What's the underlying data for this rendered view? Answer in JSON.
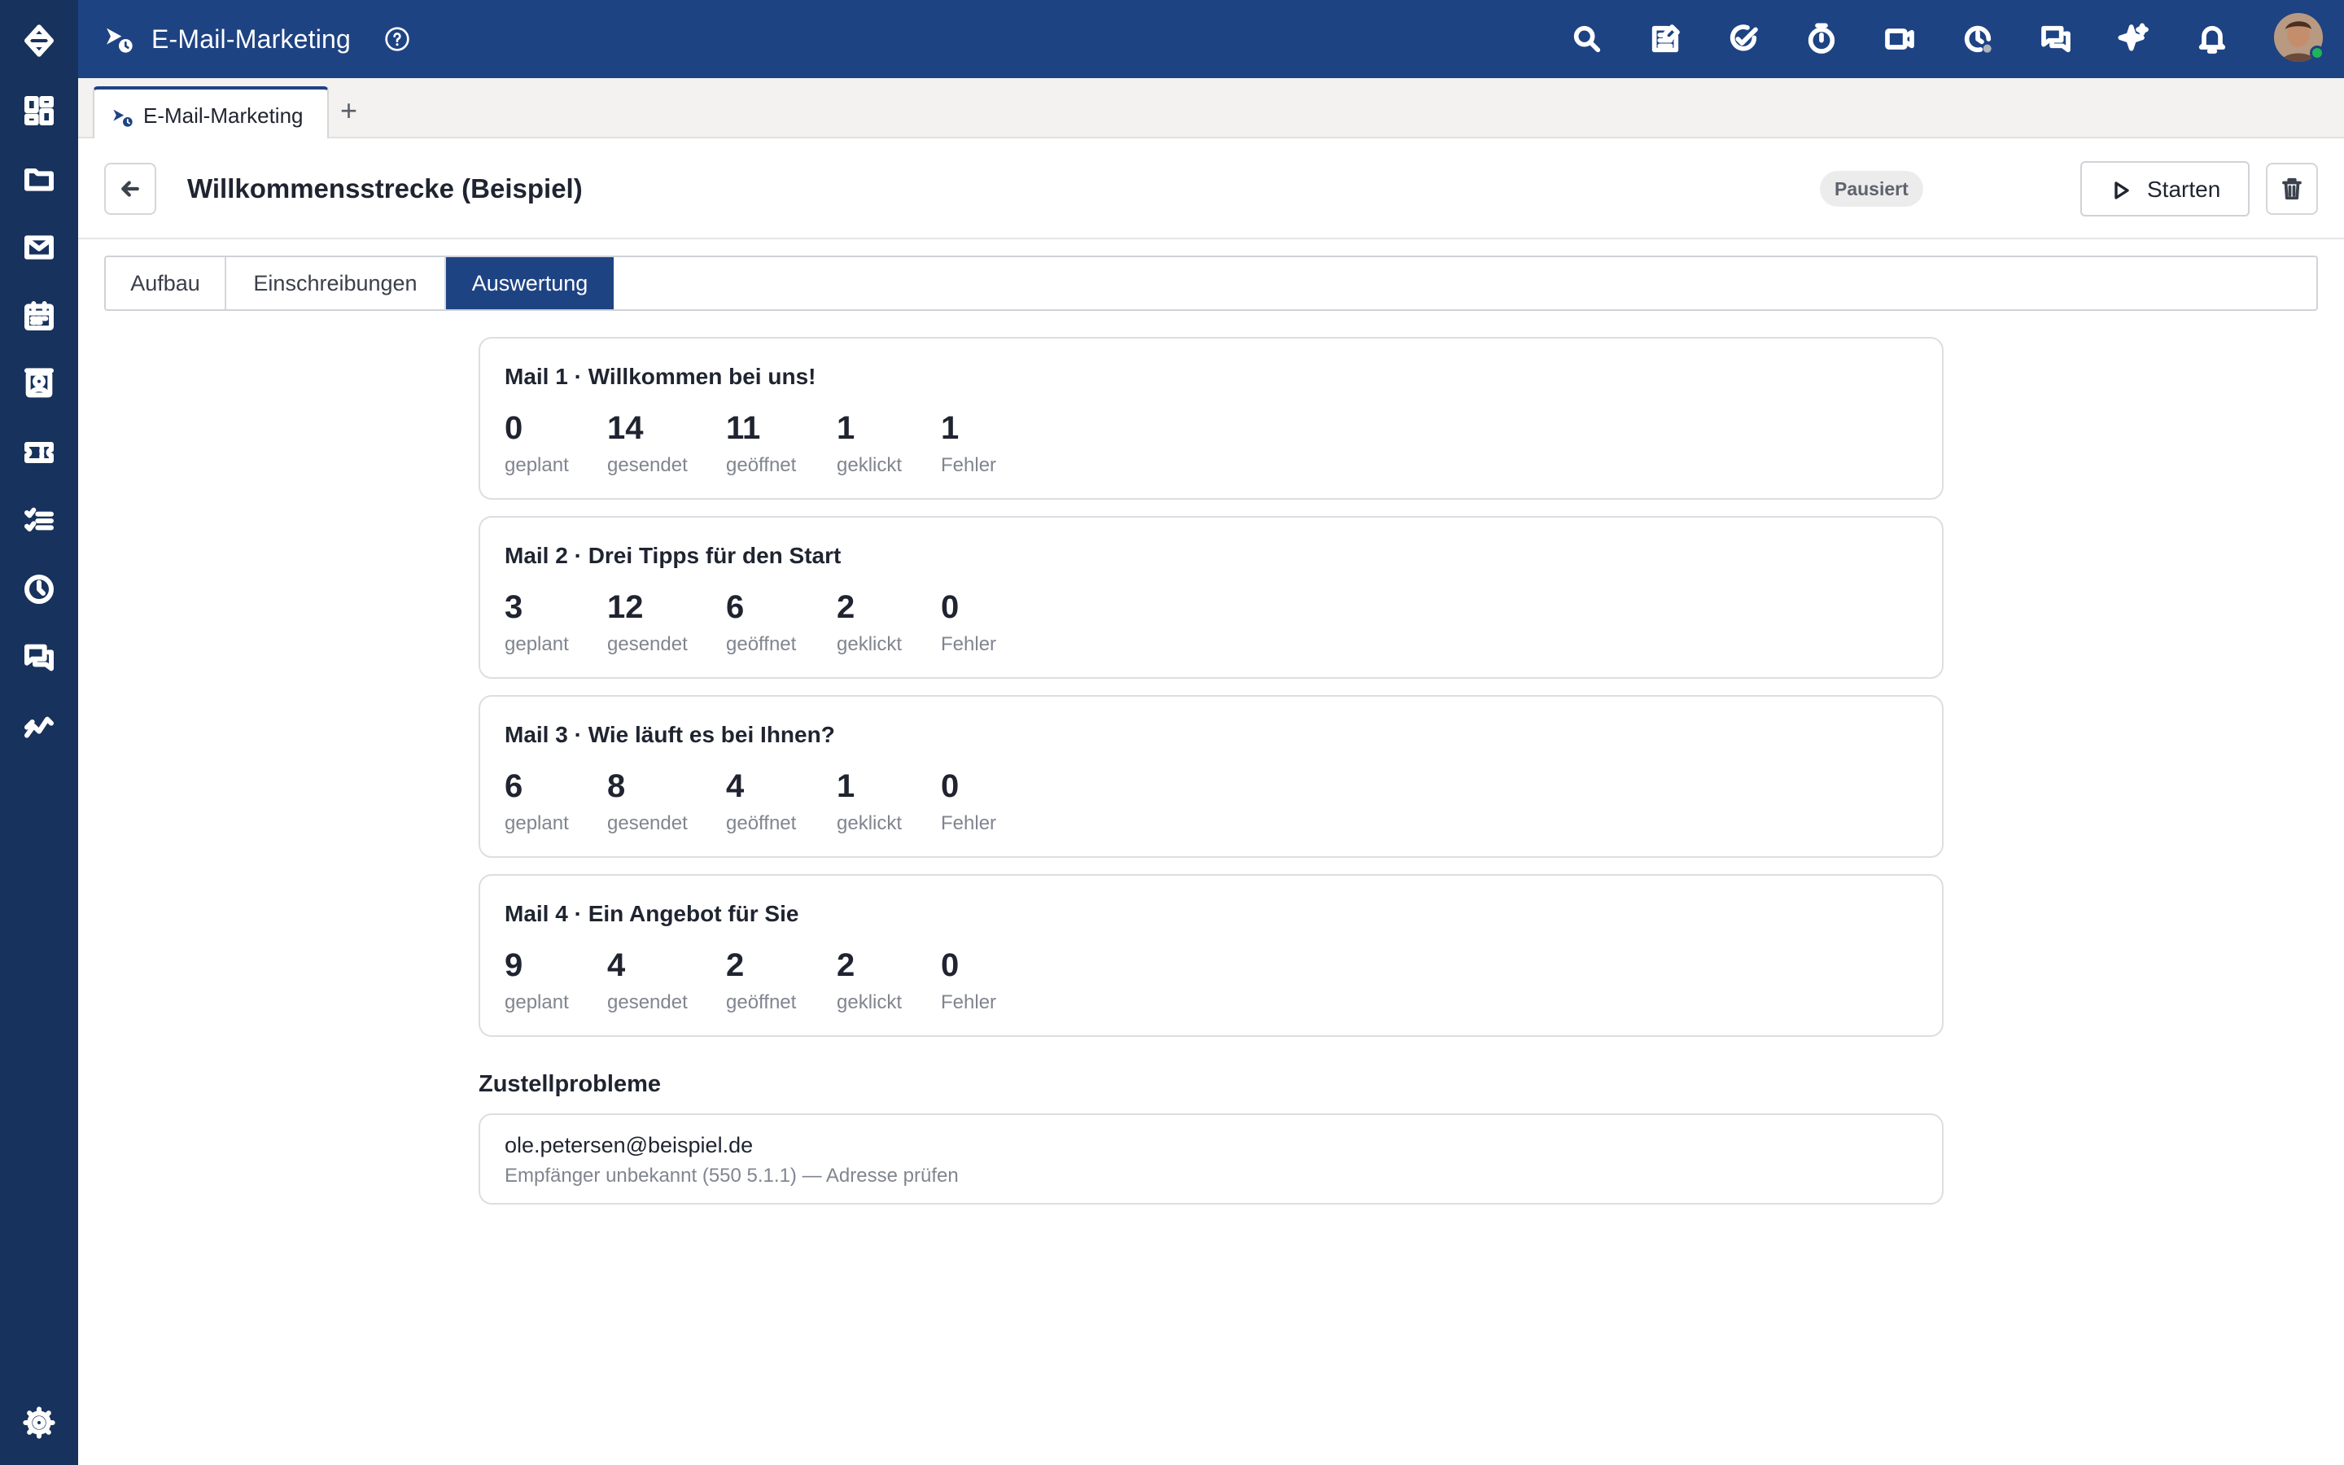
{
  "app": {
    "title": "E-Mail-Marketing",
    "accent_color": "#1e4383",
    "rail_color": "#17325c"
  },
  "rail": {
    "items": [
      {
        "icon": "swap-logo-icon"
      },
      {
        "icon": "dashboard-grid-icon"
      },
      {
        "icon": "folder-icon"
      },
      {
        "icon": "mail-icon"
      },
      {
        "icon": "calendar-icon"
      },
      {
        "icon": "contact-card-icon"
      },
      {
        "icon": "ticket-icon"
      },
      {
        "icon": "checklist-icon"
      },
      {
        "icon": "clock-icon"
      },
      {
        "icon": "chat-icon"
      },
      {
        "icon": "analytics-icon"
      },
      {
        "icon": "settings-gear-icon"
      }
    ]
  },
  "topbar": {
    "tools": [
      "search-icon",
      "notes-icon",
      "task-check-icon",
      "timer-icon",
      "video-icon",
      "time-tracking-icon",
      "chat-icon",
      "ai-sparkle-icon",
      "bell-icon"
    ]
  },
  "tabs": {
    "open": [
      {
        "label": "E-Mail-Marketing"
      }
    ],
    "add_symbol": "+"
  },
  "header": {
    "title": "Willkommensstrecke (Beispiel)",
    "status": "Pausiert",
    "start_label": "Starten"
  },
  "view_tabs": [
    {
      "label": "Aufbau",
      "active": false
    },
    {
      "label": "Einschreibungen",
      "active": false
    },
    {
      "label": "Auswertung",
      "active": true
    }
  ],
  "stat_labels": [
    "geplant",
    "gesendet",
    "geöffnet",
    "geklickt",
    "Fehler"
  ],
  "mails": [
    {
      "title": "Mail 1 · Willkommen bei uns!",
      "stats": [
        "0",
        "14",
        "11",
        "1",
        "1"
      ]
    },
    {
      "title": "Mail 2 · Drei Tipps für den Start",
      "stats": [
        "3",
        "12",
        "6",
        "2",
        "0"
      ]
    },
    {
      "title": "Mail 3 · Wie läuft es bei Ihnen?",
      "stats": [
        "6",
        "8",
        "4",
        "1",
        "0"
      ]
    },
    {
      "title": "Mail 4 · Ein Angebot für Sie",
      "stats": [
        "9",
        "4",
        "2",
        "2",
        "0"
      ]
    }
  ],
  "delivery_problems": {
    "title": "Zustellprobleme",
    "items": [
      {
        "email": "ole.petersen@beispiel.de",
        "reason": "Empfänger unbekannt (550 5.1.1) — Adresse prüfen"
      }
    ]
  }
}
